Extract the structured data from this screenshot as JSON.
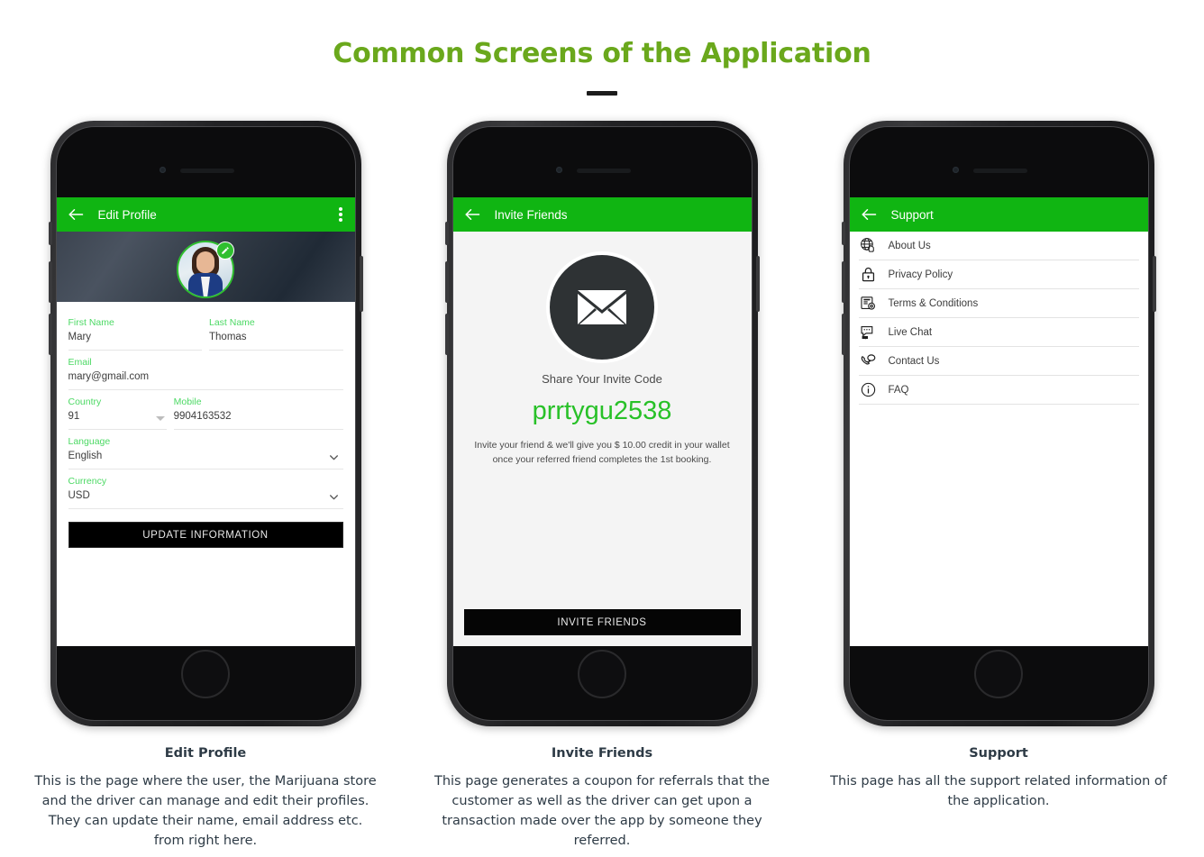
{
  "page": {
    "title": "Common Screens of the Application",
    "title_color": "#6aa81c",
    "accent_green": "#10b512",
    "label_green": "#4cd964",
    "code_green": "#28c128"
  },
  "screens": [
    {
      "id": "edit-profile",
      "appbar": {
        "title": "Edit Profile",
        "back_icon": "arrow-left-icon",
        "menu_icon": "kebab-menu-icon"
      },
      "avatar": {
        "badge_icon": "pencil-edit-icon",
        "alt": "user-profile-photo"
      },
      "fields": [
        {
          "label": "First Name",
          "value": "Mary"
        },
        {
          "label": "Last Name",
          "value": "Thomas"
        },
        {
          "label": "Email",
          "value": "mary@gmail.com"
        },
        {
          "label": "Country",
          "value": "91"
        },
        {
          "label": "Mobile",
          "value": "9904163532"
        },
        {
          "label": "Language",
          "value": "English"
        },
        {
          "label": "Currency",
          "value": "USD"
        }
      ],
      "cta": "UPDATE INFORMATION",
      "caption_title": "Edit Profile",
      "caption_text": "This is the page where the user, the Marijuana store and the driver can manage and edit their profiles. They can update their name, email address etc. from right here."
    },
    {
      "id": "invite-friends",
      "appbar": {
        "title": "Invite Friends",
        "back_icon": "arrow-left-icon"
      },
      "hero_icon": "envelope-mail-icon",
      "share_label": "Share Your Invite Code",
      "invite_code": "prrtygu2538",
      "description": "Invite your friend & we'll give you $ 10.00 credit in your wallet once your referred friend completes the 1st booking.",
      "cta": "INVITE FRIENDS",
      "caption_title": "Invite Friends",
      "caption_text": "This page generates a coupon for referrals that the customer as well as the driver can get upon a transaction made over the app by someone they referred."
    },
    {
      "id": "support",
      "appbar": {
        "title": "Support",
        "back_icon": "arrow-left-icon"
      },
      "items": [
        {
          "label": "About Us",
          "icon": "globe-hand-icon"
        },
        {
          "label": "Privacy Policy",
          "icon": "padlock-icon"
        },
        {
          "label": "Terms & Conditions",
          "icon": "document-gear-icon"
        },
        {
          "label": "Live Chat",
          "icon": "live-chat-bubble-icon"
        },
        {
          "label": "Contact Us",
          "icon": "phone-bubble-icon"
        },
        {
          "label": "FAQ",
          "icon": "info-circle-icon"
        }
      ],
      "caption_title": "Support",
      "caption_text": "This page has all the support related information of the application."
    }
  ]
}
